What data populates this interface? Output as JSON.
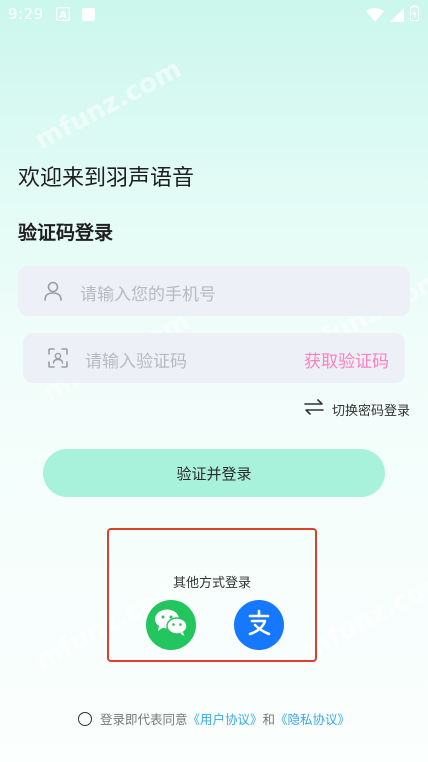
{
  "status_bar": {
    "time": "9:29"
  },
  "watermark_text": "mfunz.com",
  "welcome_title": "欢迎来到羽声语音",
  "login_subtitle": "验证码登录",
  "phone_field": {
    "placeholder": "请输入您的手机号",
    "icon": "user-icon"
  },
  "code_field": {
    "placeholder": "请输入验证码",
    "icon": "scan-face-icon",
    "get_code_label": "获取验证码"
  },
  "switch_login": {
    "label": "切换密码登录",
    "icon": "swap-icon"
  },
  "submit_label": "验证并登录",
  "other_login": {
    "label": "其他方式登录",
    "providers": [
      "wechat-icon",
      "alipay-icon"
    ]
  },
  "agreement": {
    "prefix": "登录即代表同意",
    "user_agreement": "《用户协议》",
    "conjunction": "和",
    "privacy_policy": "《隐私协议》"
  },
  "colors": {
    "accent_button": "#a8f2dc",
    "get_code": "#ff7fbf",
    "link": "#38a8e8",
    "wechat": "#22c55e",
    "alipay": "#1677ff",
    "highlight_box": "#d9412c"
  }
}
